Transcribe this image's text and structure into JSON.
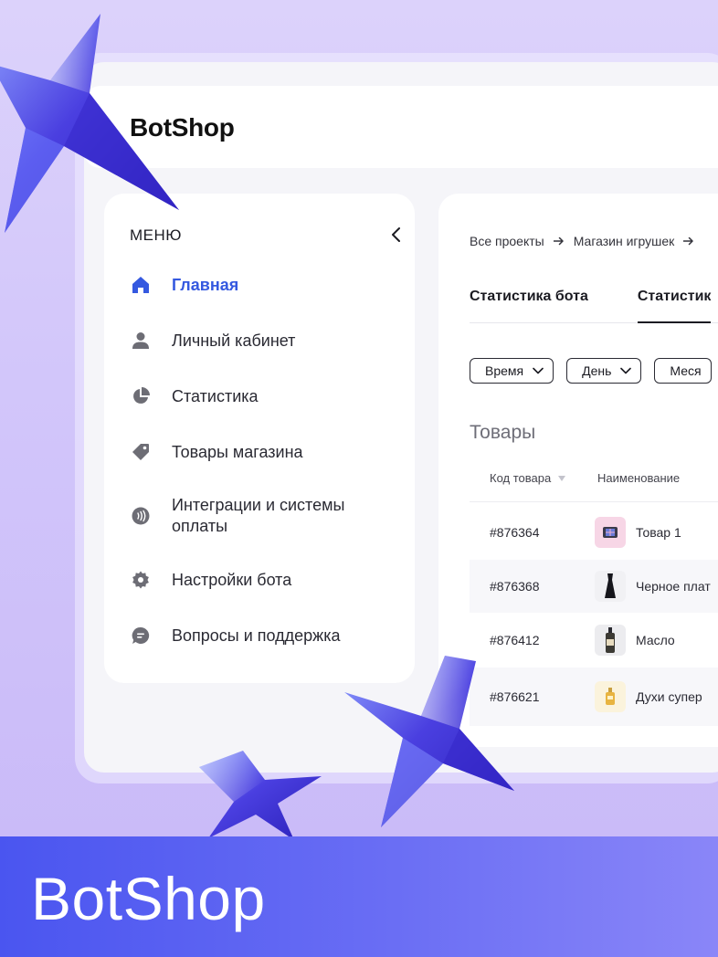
{
  "header": {
    "logo": "BotShop"
  },
  "sidebar": {
    "title": "МЕНЮ",
    "items": [
      {
        "label": "Главная",
        "icon": "home-icon",
        "active": true
      },
      {
        "label": "Личный кабинет",
        "icon": "user-icon"
      },
      {
        "label": "Статистика",
        "icon": "pie-chart-icon"
      },
      {
        "label": "Товары магазина",
        "icon": "tag-icon"
      },
      {
        "label": "Интеграции и системы оплаты",
        "icon": "contactless-icon"
      },
      {
        "label": "Настройки бота",
        "icon": "gear-icon"
      },
      {
        "label": "Вопросы и поддержка",
        "icon": "chat-icon"
      }
    ]
  },
  "main": {
    "breadcrumb": [
      "Все проекты",
      "Магазин игрушек"
    ],
    "tabs": [
      "Статистика бота",
      "Статистик"
    ],
    "filters": [
      "Время",
      "День",
      "Меся"
    ],
    "section_title": "Товары",
    "table": {
      "headers": [
        "Код товара",
        "Наименование"
      ],
      "rows": [
        {
          "code": "#876364",
          "name": "Товар 1",
          "thumb": "pink-box-icon"
        },
        {
          "code": "#876368",
          "name": "Черное плат",
          "thumb": "black-dress-icon"
        },
        {
          "code": "#876412",
          "name": "Масло",
          "thumb": "oil-bottle-icon"
        },
        {
          "code": "#876621",
          "name": "Духи супер",
          "thumb": "perfume-icon"
        }
      ]
    }
  },
  "banner": {
    "title": "BotShop"
  },
  "colors": {
    "accent": "#3559e0",
    "banner_start": "#4a55f0",
    "banner_end": "#8a86f8",
    "background": "#dcd2fb"
  }
}
